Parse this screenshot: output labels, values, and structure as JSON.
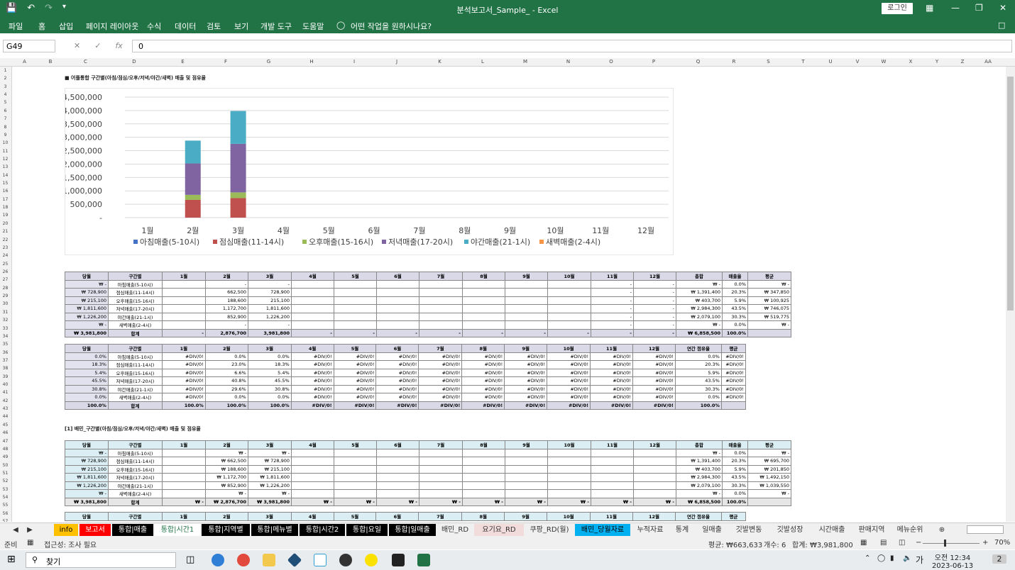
{
  "window": {
    "title": "분석보고서_Sample_  -  Excel",
    "login": "로그인"
  },
  "menu": [
    "파일",
    "홈",
    "삽입",
    "페이지 레이아웃",
    "수식",
    "데이터",
    "검토",
    "보기",
    "개발 도구",
    "도움말"
  ],
  "tellme": "어떤 작업을 원하시나요?",
  "namebox": "G49",
  "formula": "0",
  "columns": [
    "A",
    "B",
    "C",
    "D",
    "E",
    "F",
    "G",
    "H",
    "I",
    "J",
    "K",
    "L",
    "M",
    "N",
    "O",
    "P",
    "Q",
    "R",
    "S",
    "T",
    "U",
    "V",
    "W",
    "X",
    "Y",
    "Z",
    "AA"
  ],
  "rows": [
    "1",
    "2",
    "3",
    "4",
    "5",
    "6",
    "7",
    "8",
    "9",
    "10",
    "11",
    "12",
    "13",
    "14",
    "15",
    "16",
    "17",
    "18",
    "19",
    "20",
    "21",
    "22",
    "23",
    "24",
    "25",
    "26",
    "27",
    "28",
    "29",
    "30",
    "31",
    "32",
    "33",
    "34",
    "35",
    "36",
    "37",
    "38",
    "39",
    "40",
    "41",
    "42",
    "43",
    "44",
    "45",
    "46",
    "47",
    "48",
    "49",
    "50",
    "51",
    "52",
    "53",
    "54",
    "55",
    "56",
    "57"
  ],
  "section1_title": "■ 어플통합 구간별(아침/점심/오후/저녁/야간/새벽) 매출 및 점유율",
  "section2_title": "[1] 배민_구간별(아침/점심/오후/저녁/야간/새벽) 매출 및 점유율",
  "chart_data": {
    "type": "bar",
    "stacked": true,
    "categories": [
      "1월",
      "2월",
      "3월",
      "4월",
      "5월",
      "6월",
      "7월",
      "8월",
      "9월",
      "10월",
      "11월",
      "12월"
    ],
    "series": [
      {
        "name": "아침매출(5-10시)",
        "color": "#4472c4",
        "values": [
          0,
          0,
          0,
          0,
          0,
          0,
          0,
          0,
          0,
          0,
          0,
          0
        ]
      },
      {
        "name": "점심매출(11-14시)",
        "color": "#c0504d",
        "values": [
          0,
          662500,
          728900,
          0,
          0,
          0,
          0,
          0,
          0,
          0,
          0,
          0
        ]
      },
      {
        "name": "오후매출(15-16시)",
        "color": "#9bbb59",
        "values": [
          0,
          188600,
          215100,
          0,
          0,
          0,
          0,
          0,
          0,
          0,
          0,
          0
        ]
      },
      {
        "name": "저녁매출(17-20시)",
        "color": "#8064a2",
        "values": [
          0,
          1172700,
          1811600,
          0,
          0,
          0,
          0,
          0,
          0,
          0,
          0,
          0
        ]
      },
      {
        "name": "야간매출(21-1시)",
        "color": "#4bacc6",
        "values": [
          0,
          852900,
          1226200,
          0,
          0,
          0,
          0,
          0,
          0,
          0,
          0,
          0
        ]
      },
      {
        "name": "새벽매출(2-4시)",
        "color": "#f79646",
        "values": [
          0,
          0,
          0,
          0,
          0,
          0,
          0,
          0,
          0,
          0,
          0,
          0
        ]
      }
    ],
    "ylim": [
      0,
      4500000
    ],
    "yticks": [
      "-",
      "500,000",
      "1,000,000",
      "1,500,000",
      "2,000,000",
      "2,500,000",
      "3,000,000",
      "3,500,000",
      "4,000,000",
      "4,500,000"
    ],
    "legend": "bottom",
    "grid": true
  },
  "table1": {
    "header": [
      "당월",
      "구간별",
      "1월",
      "2월",
      "3월",
      "4월",
      "5월",
      "6월",
      "7월",
      "8월",
      "9월",
      "10월",
      "11월",
      "12월",
      "총합",
      "매출율",
      "평균"
    ],
    "rows": [
      [
        "₩          -",
        "아침매출(5-10시)",
        "",
        "-",
        "-",
        "",
        "",
        "",
        "",
        "",
        "",
        "",
        "-",
        "-",
        "₩          -",
        "0.0%",
        "₩          -"
      ],
      [
        "₩   728,900",
        "점심매출(11-14시)",
        "",
        "662,500",
        "728,900",
        "",
        "",
        "",
        "",
        "",
        "",
        "",
        "-",
        "-",
        "₩ 1,391,400",
        "20.3%",
        "₩   347,850"
      ],
      [
        "₩   215,100",
        "오후매출(15-16시)",
        "",
        "188,600",
        "215,100",
        "",
        "",
        "",
        "",
        "",
        "",
        "",
        "-",
        "-",
        "₩   403,700",
        "5.9%",
        "₩   100,925"
      ],
      [
        "₩ 1,811,600",
        "저녁매출(17-20시)",
        "",
        "1,172,700",
        "1,811,600",
        "",
        "",
        "",
        "",
        "",
        "",
        "",
        "-",
        "-",
        "₩ 2,984,300",
        "43.5%",
        "₩   746,075"
      ],
      [
        "₩ 1,226,200",
        "야간매출(21-1시)",
        "",
        "852,900",
        "1,226,200",
        "",
        "",
        "",
        "",
        "",
        "",
        "",
        "-",
        "-",
        "₩ 2,079,100",
        "30.3%",
        "₩   519,775"
      ],
      [
        "₩          -",
        "새벽매출(2-4시)",
        "",
        "-",
        "-",
        "",
        "",
        "",
        "",
        "",
        "",
        "",
        "-",
        "-",
        "₩          -",
        "0.0%",
        "₩          -"
      ]
    ],
    "total": [
      "₩ 3,981,800",
      "합계",
      "-",
      "2,876,700",
      "3,981,800",
      "-",
      "-",
      "-",
      "-",
      "-",
      "-",
      "-",
      "-",
      "-",
      "₩ 6,858,500",
      "100.0%",
      ""
    ]
  },
  "table2": {
    "header": [
      "당월",
      "구간별",
      "1월",
      "2월",
      "3월",
      "4월",
      "5월",
      "6월",
      "7월",
      "8월",
      "9월",
      "10월",
      "11월",
      "12월",
      "연간 점유율",
      "평균"
    ],
    "rows": [
      [
        "0.0%",
        "아침매출(5-10시)",
        "#DIV/0!",
        "0.0%",
        "0.0%",
        "#DIV/0!",
        "#DIV/0!",
        "#DIV/0!",
        "#DIV/0!",
        "#DIV/0!",
        "#DIV/0!",
        "#DIV/0!",
        "#DIV/0!",
        "#DIV/0!",
        "0.0%",
        "#DIV/0!"
      ],
      [
        "18.3%",
        "점심매출(11-14시)",
        "#DIV/0!",
        "23.0%",
        "18.3%",
        "#DIV/0!",
        "#DIV/0!",
        "#DIV/0!",
        "#DIV/0!",
        "#DIV/0!",
        "#DIV/0!",
        "#DIV/0!",
        "#DIV/0!",
        "#DIV/0!",
        "20.3%",
        "#DIV/0!"
      ],
      [
        "5.4%",
        "오후매출(15-16시)",
        "#DIV/0!",
        "6.6%",
        "5.4%",
        "#DIV/0!",
        "#DIV/0!",
        "#DIV/0!",
        "#DIV/0!",
        "#DIV/0!",
        "#DIV/0!",
        "#DIV/0!",
        "#DIV/0!",
        "#DIV/0!",
        "5.9%",
        "#DIV/0!"
      ],
      [
        "45.5%",
        "저녁매출(17-20시)",
        "#DIV/0!",
        "40.8%",
        "45.5%",
        "#DIV/0!",
        "#DIV/0!",
        "#DIV/0!",
        "#DIV/0!",
        "#DIV/0!",
        "#DIV/0!",
        "#DIV/0!",
        "#DIV/0!",
        "#DIV/0!",
        "43.5%",
        "#DIV/0!"
      ],
      [
        "30.8%",
        "야간매출(21-1시)",
        "#DIV/0!",
        "29.6%",
        "30.8%",
        "#DIV/0!",
        "#DIV/0!",
        "#DIV/0!",
        "#DIV/0!",
        "#DIV/0!",
        "#DIV/0!",
        "#DIV/0!",
        "#DIV/0!",
        "#DIV/0!",
        "30.3%",
        "#DIV/0!"
      ],
      [
        "0.0%",
        "새벽매출(2-4시)",
        "#DIV/0!",
        "0.0%",
        "0.0%",
        "#DIV/0!",
        "#DIV/0!",
        "#DIV/0!",
        "#DIV/0!",
        "#DIV/0!",
        "#DIV/0!",
        "#DIV/0!",
        "#DIV/0!",
        "#DIV/0!",
        "0.0%",
        "#DIV/0!"
      ]
    ],
    "total": [
      "100.0%",
      "합계",
      "100.0%",
      "100.0%",
      "100.0%",
      "#DIV/0!",
      "#DIV/0!",
      "#DIV/0!",
      "#DIV/0!",
      "#DIV/0!",
      "#DIV/0!",
      "#DIV/0!",
      "#DIV/0!",
      "#DIV/0!",
      "100.0%",
      ""
    ]
  },
  "table3": {
    "header": [
      "당월",
      "구간별",
      "1월",
      "2월",
      "3월",
      "4월",
      "5월",
      "6월",
      "7월",
      "8월",
      "9월",
      "10월",
      "11월",
      "12월",
      "총합",
      "매출율",
      "평균"
    ],
    "rows": [
      [
        "₩          -",
        "아침매출(5-10시)",
        "",
        "₩          -",
        "₩          -",
        "",
        "",
        "",
        "",
        "",
        "",
        "",
        "",
        "",
        "₩          -",
        "0.0%",
        "₩          -"
      ],
      [
        "₩   728,900",
        "점심매출(11-14시)",
        "",
        "₩   662,500",
        "₩   728,900",
        "",
        "",
        "",
        "",
        "",
        "",
        "",
        "",
        "",
        "₩ 1,391,400",
        "20.3%",
        "₩   695,700"
      ],
      [
        "₩   215,100",
        "오후매출(15-16시)",
        "",
        "₩   188,600",
        "₩   215,100",
        "",
        "",
        "",
        "",
        "",
        "",
        "",
        "",
        "",
        "₩   403,700",
        "5.9%",
        "₩   201,850"
      ],
      [
        "₩ 1,811,600",
        "저녁매출(17-20시)",
        "",
        "₩ 1,172,700",
        "₩ 1,811,600",
        "",
        "",
        "",
        "",
        "",
        "",
        "",
        "",
        "",
        "₩ 2,984,300",
        "43.5%",
        "₩ 1,492,150"
      ],
      [
        "₩ 1,226,200",
        "야간매출(21-1시)",
        "",
        "₩   852,900",
        "₩ 1,226,200",
        "",
        "",
        "",
        "",
        "",
        "",
        "",
        "",
        "",
        "₩ 2,079,100",
        "30.3%",
        "₩ 1,039,550"
      ],
      [
        "₩          -",
        "새벽매출(2-4시)",
        "",
        "₩          -",
        "₩          -",
        "",
        "",
        "",
        "",
        "",
        "",
        "",
        "",
        "",
        "₩          -",
        "0.0%",
        "₩          -"
      ]
    ],
    "total": [
      "₩ 3,981,800",
      "합계",
      "₩          -",
      "₩ 2,876,700",
      "₩ 3,981,800",
      "₩          -",
      "₩          -",
      "₩          -",
      "₩          -",
      "₩          -",
      "₩          -",
      "₩          -",
      "₩          -",
      "₩          -",
      "₩ 6,858,500",
      "100.0%",
      ""
    ]
  },
  "table4_header": [
    "당월",
    "구간별",
    "1월",
    "2월",
    "3월",
    "4월",
    "5월",
    "6월",
    "7월",
    "8월",
    "9월",
    "10월",
    "11월",
    "12월",
    "연간 점유율",
    "평균"
  ],
  "tabs": [
    {
      "label": "info",
      "bg": "#ffc000",
      "fg": "#000000"
    },
    {
      "label": "보고서",
      "bg": "#ff0000",
      "fg": "#ffffff"
    },
    {
      "label": "통합|매출",
      "bg": "#000000",
      "fg": "#ffffff"
    },
    {
      "label": "통합|시간1",
      "bg": "#ffffff",
      "fg": "#217346"
    },
    {
      "label": "통합|지역별",
      "bg": "#000000",
      "fg": "#ffffff"
    },
    {
      "label": "통합|메뉴별",
      "bg": "#000000",
      "fg": "#ffffff"
    },
    {
      "label": "통합|시간2",
      "bg": "#000000",
      "fg": "#ffffff"
    },
    {
      "label": "통합|요일",
      "bg": "#000000",
      "fg": "#ffffff"
    },
    {
      "label": "통합|일매출",
      "bg": "#000000",
      "fg": "#ffffff"
    },
    {
      "label": "배민_RD",
      "bg": "#f0f0f0",
      "fg": "#333333"
    },
    {
      "label": "요기요_RD",
      "bg": "#f2dcdb",
      "fg": "#333333"
    },
    {
      "label": "쿠팡_RD(월)",
      "bg": "#f0f0f0",
      "fg": "#333333"
    },
    {
      "label": "배민_당월자료",
      "bg": "#00b0f0",
      "fg": "#000000"
    },
    {
      "label": "누적자료",
      "bg": "#f0f0f0",
      "fg": "#333333"
    },
    {
      "label": "통계",
      "bg": "#f0f0f0",
      "fg": "#333333"
    },
    {
      "label": "일매출",
      "bg": "#f0f0f0",
      "fg": "#333333"
    },
    {
      "label": "깃발변동",
      "bg": "#f0f0f0",
      "fg": "#333333"
    },
    {
      "label": "깃발성장",
      "bg": "#f0f0f0",
      "fg": "#333333"
    },
    {
      "label": "시간매출",
      "bg": "#f0f0f0",
      "fg": "#333333"
    },
    {
      "label": "판매지역",
      "bg": "#f0f0f0",
      "fg": "#333333"
    },
    {
      "label": "메뉴순위",
      "bg": "#f0f0f0",
      "fg": "#333333"
    }
  ],
  "status": {
    "ready": "준비",
    "access": "접근성: 조사 필요",
    "avg": "평균: ₩663,633",
    "count": "개수: 6",
    "sum": "합계: ₩3,981,800",
    "zoom": "70%"
  },
  "taskbar": {
    "search": "찾기",
    "ime": "가",
    "time": "오전 12:34",
    "date": "2023-06-13",
    "notif": "2"
  }
}
